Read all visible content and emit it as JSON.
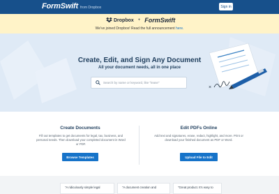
{
  "header": {
    "logo_text": "FormSwift",
    "logo_from": "from Dropbox",
    "signin_label": "Sign in"
  },
  "announcement": {
    "partner_a": "Dropbox",
    "plus": "+",
    "partner_b": "FormSwift",
    "message": "We've joined Dropbox! Read the full announcement ",
    "link_text": "here."
  },
  "hero": {
    "title": "Create, Edit, and Sign Any Document",
    "subtitle": "All your document needs, all in one place",
    "search_placeholder": "Search by name or keyword, like \"lease\""
  },
  "create": {
    "title": "Create Documents",
    "description": "Fill out templates to get documents for legal, tax, business, and personal needs. Then download your completed document in Word or PDF.",
    "button": "Browse Templates"
  },
  "edit": {
    "title": "Edit PDFs Online",
    "description": "Add text and signatures, erase, redact, highlight, and more. Print or download your finished document as PDF or Word.",
    "button": "Upload File to Edit"
  },
  "testimonials": [
    "\"A ridiculously simple legal",
    "\"A document creation and",
    "\"Great product. It's easy to"
  ],
  "colors": {
    "topbar": "#17508b",
    "announce_bg": "#fff3c8",
    "hero_bg": "#dfeaf6",
    "accent": "#1673c9"
  }
}
